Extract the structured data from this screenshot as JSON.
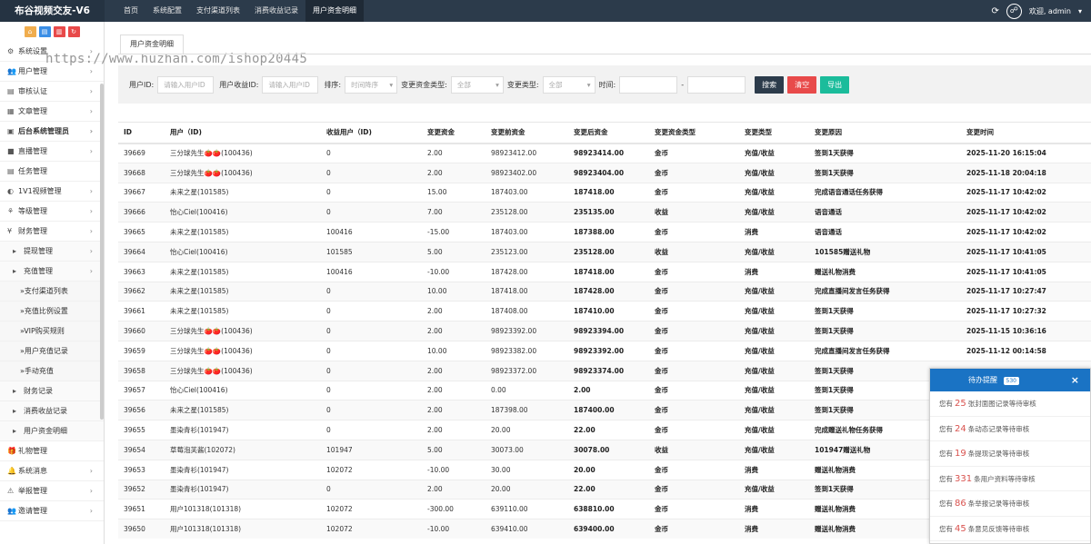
{
  "app": {
    "title": "布谷视频交友-V6"
  },
  "topnav": [
    "首页",
    "系统配置",
    "支付渠道列表",
    "消费收益记录",
    "用户资金明细"
  ],
  "topright": {
    "welcome": "欢迎, admin",
    "dropdown": "▾"
  },
  "watermark": "https://www.huzhan.com/ishop20445",
  "sidebar": {
    "items": [
      {
        "label": "系统设置",
        "icon": "⚙",
        "arrow": "›"
      },
      {
        "label": "用户管理",
        "icon": "👥",
        "arrow": "›"
      },
      {
        "label": "审核认证",
        "icon": "▤",
        "arrow": "›"
      },
      {
        "label": "文章管理",
        "icon": "▦",
        "arrow": "›"
      },
      {
        "label": "后台系统管理员",
        "icon": "▣",
        "arrow": "›"
      },
      {
        "label": "直播管理",
        "icon": "■",
        "arrow": "›"
      },
      {
        "label": "任务管理",
        "icon": "▤",
        "arrow": ""
      },
      {
        "label": "1V1视频管理",
        "icon": "◐",
        "arrow": "›"
      },
      {
        "label": "等级管理",
        "icon": "⚘",
        "arrow": "›"
      },
      {
        "label": "财务管理",
        "icon": "¥",
        "arrow": "›"
      },
      {
        "label": "提现管理",
        "icon": "▸",
        "arrow": "›"
      },
      {
        "label": "充值管理",
        "icon": "▸",
        "arrow": "›"
      },
      {
        "label": "»支付渠道列表",
        "icon": "",
        "arrow": ""
      },
      {
        "label": "»充值比例设置",
        "icon": "",
        "arrow": ""
      },
      {
        "label": "»VIP购买规则",
        "icon": "",
        "arrow": ""
      },
      {
        "label": "»用户充值记录",
        "icon": "",
        "arrow": ""
      },
      {
        "label": "»手动充值",
        "icon": "",
        "arrow": ""
      },
      {
        "label": "财务记录",
        "icon": "▸",
        "arrow": ""
      },
      {
        "label": "消费收益记录",
        "icon": "▸",
        "arrow": ""
      },
      {
        "label": "用户资金明细",
        "icon": "▸",
        "arrow": ""
      },
      {
        "label": "礼物管理",
        "icon": "🎁",
        "arrow": ""
      },
      {
        "label": "系统消息",
        "icon": "🔔",
        "arrow": "›"
      },
      {
        "label": "举报管理",
        "icon": "⚠",
        "arrow": "›"
      },
      {
        "label": "邀请管理",
        "icon": "👥",
        "arrow": "›"
      }
    ]
  },
  "tab": {
    "label": "用户资金明细"
  },
  "filter": {
    "user_id_label": "用户ID:",
    "user_id_placeholder": "请输入用户ID",
    "income_id_label": "用户收益ID:",
    "income_id_placeholder": "请输入用户ID",
    "sort_label": "排序:",
    "sort_value": "时间降序",
    "fund_type_label": "变更资金类型:",
    "fund_type_value": "全部",
    "change_type_label": "变更类型:",
    "change_type_value": "全部",
    "time_label": "时间:",
    "time_sep": "-",
    "search": "搜索",
    "clear": "清空",
    "export": "导出"
  },
  "table": {
    "headers": [
      "ID",
      "用户（ID)",
      "收益用户（ID)",
      "变更资金",
      "变更前资金",
      "变更后资金",
      "变更资金类型",
      "变更类型",
      "变更原因",
      "变更时间"
    ],
    "rows": [
      [
        "39669",
        "三分球先生🍅🍅(100436)",
        "0",
        "2.00",
        "98923412.00",
        "98923414.00",
        "金币",
        "充值/收益",
        "签到1天获得",
        "2025-11-20 16:15:04"
      ],
      [
        "39668",
        "三分球先生🍅🍅(100436)",
        "0",
        "2.00",
        "98923402.00",
        "98923404.00",
        "金币",
        "充值/收益",
        "签到1天获得",
        "2025-11-18 20:04:18"
      ],
      [
        "39667",
        "未来之星(101585)",
        "0",
        "15.00",
        "187403.00",
        "187418.00",
        "金币",
        "充值/收益",
        "完成语音通话任务获得",
        "2025-11-17 10:42:02"
      ],
      [
        "39666",
        "怡心Ciel(100416)",
        "0",
        "7.00",
        "235128.00",
        "235135.00",
        "收益",
        "充值/收益",
        "语音通话",
        "2025-11-17 10:42:02"
      ],
      [
        "39665",
        "未来之星(101585)",
        "100416",
        "-15.00",
        "187403.00",
        "187388.00",
        "金币",
        "消费",
        "语音通话",
        "2025-11-17 10:42:02"
      ],
      [
        "39664",
        "怡心Ciel(100416)",
        "101585",
        "5.00",
        "235123.00",
        "235128.00",
        "收益",
        "充值/收益",
        "101585赠送礼物",
        "2025-11-17 10:41:05"
      ],
      [
        "39663",
        "未来之星(101585)",
        "100416",
        "-10.00",
        "187428.00",
        "187418.00",
        "金币",
        "消费",
        "赠送礼物消费",
        "2025-11-17 10:41:05"
      ],
      [
        "39662",
        "未来之星(101585)",
        "0",
        "10.00",
        "187418.00",
        "187428.00",
        "金币",
        "充值/收益",
        "完成直播间发言任务获得",
        "2025-11-17 10:27:47"
      ],
      [
        "39661",
        "未来之星(101585)",
        "0",
        "2.00",
        "187408.00",
        "187410.00",
        "金币",
        "充值/收益",
        "签到1天获得",
        "2025-11-17 10:27:32"
      ],
      [
        "39660",
        "三分球先生🍅🍅(100436)",
        "0",
        "2.00",
        "98923392.00",
        "98923394.00",
        "金币",
        "充值/收益",
        "签到1天获得",
        "2025-11-15 10:36:16"
      ],
      [
        "39659",
        "三分球先生🍅🍅(100436)",
        "0",
        "10.00",
        "98923382.00",
        "98923392.00",
        "金币",
        "充值/收益",
        "完成直播间发言任务获得",
        "2025-11-12 00:14:58"
      ],
      [
        "39658",
        "三分球先生🍅🍅(100436)",
        "0",
        "2.00",
        "98923372.00",
        "98923374.00",
        "金币",
        "充值/收益",
        "签到1天获得",
        ""
      ],
      [
        "39657",
        "怡心Ciel(100416)",
        "0",
        "2.00",
        "0.00",
        "2.00",
        "金币",
        "充值/收益",
        "签到1天获得",
        ""
      ],
      [
        "39656",
        "未来之星(101585)",
        "0",
        "2.00",
        "187398.00",
        "187400.00",
        "金币",
        "充值/收益",
        "签到1天获得",
        ""
      ],
      [
        "39655",
        "墨染青衫(101947)",
        "0",
        "2.00",
        "20.00",
        "22.00",
        "金币",
        "充值/收益",
        "完成赠送礼物任务获得",
        ""
      ],
      [
        "39654",
        "草莓泡芙酱(102072)",
        "101947",
        "5.00",
        "30073.00",
        "30078.00",
        "收益",
        "充值/收益",
        "101947赠送礼物",
        ""
      ],
      [
        "39653",
        "墨染青衫(101947)",
        "102072",
        "-10.00",
        "30.00",
        "20.00",
        "金币",
        "消费",
        "赠送礼物消费",
        ""
      ],
      [
        "39652",
        "墨染青衫(101947)",
        "0",
        "2.00",
        "20.00",
        "22.00",
        "金币",
        "充值/收益",
        "签到1天获得",
        ""
      ],
      [
        "39651",
        "用户101318(101318)",
        "102072",
        "-300.00",
        "639110.00",
        "638810.00",
        "金币",
        "消费",
        "赠送礼物消费",
        ""
      ],
      [
        "39650",
        "用户101318(101318)",
        "102072",
        "-10.00",
        "639410.00",
        "639400.00",
        "金币",
        "消费",
        "赠送礼物消费",
        ""
      ]
    ]
  },
  "popup": {
    "title": "待办提醒",
    "badge": "530",
    "close": "×",
    "rows": [
      {
        "pre": "您有",
        "num": "25",
        "post": "张封面图记录等待审核"
      },
      {
        "pre": "您有",
        "num": "24",
        "post": "条动态记录等待审核"
      },
      {
        "pre": "您有",
        "num": "19",
        "post": "条提现记录等待审核"
      },
      {
        "pre": "您有",
        "num": "331",
        "post": "条用户资料等待审核"
      },
      {
        "pre": "您有",
        "num": "86",
        "post": "条举报记录等待审核"
      },
      {
        "pre": "您有",
        "num": "45",
        "post": "条意见反馈等待审核"
      }
    ]
  },
  "colors": {
    "topbar": "#2c3b4b",
    "search": "#2c3b4b",
    "clear": "#e84a4a",
    "export": "#1bbc9b",
    "popup": "#1a73c4",
    "number": "#d9534f"
  }
}
